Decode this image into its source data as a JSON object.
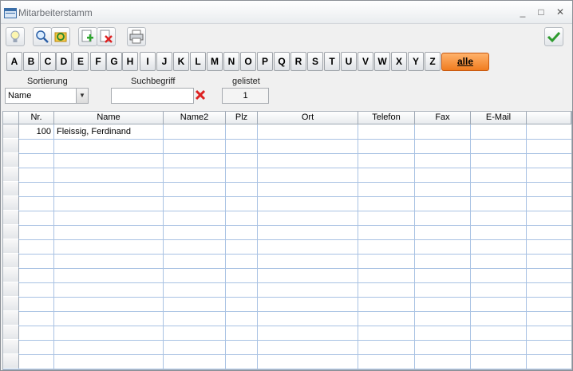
{
  "window": {
    "title": "Mitarbeiterstamm",
    "minimize": "_",
    "maximize": "□",
    "close": "✕"
  },
  "toolbar": {
    "icons": [
      "lightbulb-icon",
      "search-icon",
      "refresh-icon",
      "add-icon",
      "delete-icon",
      "print-icon",
      "confirm-icon"
    ]
  },
  "letters": [
    "A",
    "B",
    "C",
    "D",
    "E",
    "F",
    "G",
    "H",
    "I",
    "J",
    "K",
    "L",
    "M",
    "N",
    "O",
    "P",
    "Q",
    "R",
    "S",
    "T",
    "U",
    "V",
    "W",
    "X",
    "Y",
    "Z"
  ],
  "alle_label": "alle",
  "filters": {
    "sort_label": "Sortierung",
    "sort_value": "Name",
    "search_label": "Suchbegriff",
    "search_value": "",
    "count_label": "gelistet",
    "count_value": "1"
  },
  "table": {
    "columns": [
      "Nr.",
      "Name",
      "Name2",
      "Plz",
      "Ort",
      "Telefon",
      "Fax",
      "E-Mail"
    ],
    "rows": [
      {
        "nr": "100",
        "name": "Fleissig, Ferdinand",
        "name2": "",
        "plz": "",
        "ort": "",
        "telefon": "",
        "fax": "",
        "email": ""
      }
    ]
  },
  "colors": {
    "alle_button": "#f07c1f",
    "grid_line": "#a9c2e3"
  }
}
